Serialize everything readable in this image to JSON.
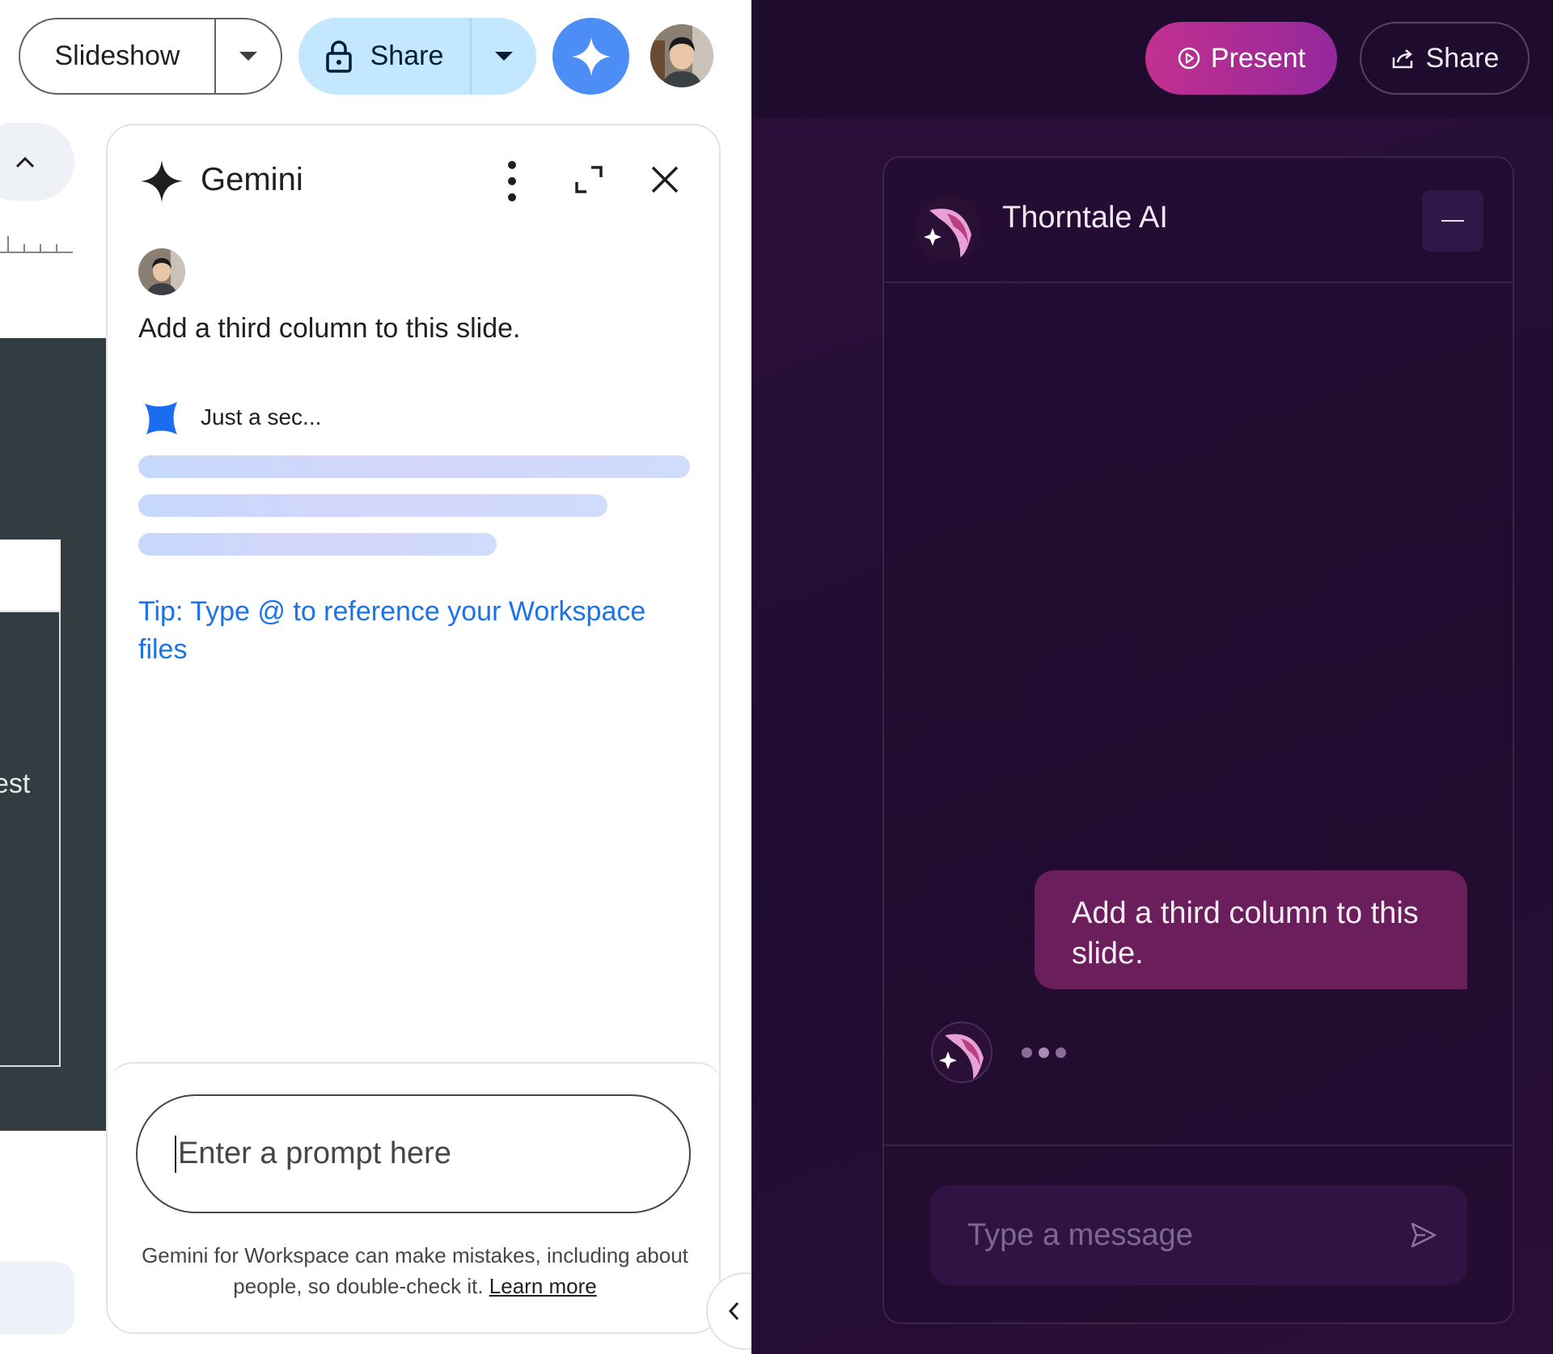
{
  "left": {
    "toolbar": {
      "slideshow_label": "Slideshow",
      "share_label": "Share"
    },
    "slide": {
      "partial_text": "est"
    },
    "gemini": {
      "title": "Gemini",
      "user_message": "Add a third column to this slide.",
      "loading_text": "Just a sec...",
      "tip": "Tip: Type @ to reference your Workspace files",
      "input_placeholder": "Enter a prompt here",
      "disclaimer": "Gemini for Workspace can make mistakes, including about people, so double-check it.",
      "learn_more": "Learn more"
    }
  },
  "right": {
    "present_label": "Present",
    "share_label": "Share",
    "chat": {
      "title": "Thorntale AI",
      "user_message": "Add a third column to this slide.",
      "input_placeholder": "Type a message"
    }
  },
  "icons": [
    "chevron-down-icon",
    "lock-icon",
    "gemini-spark-icon",
    "more-vert-icon",
    "expand-icon",
    "close-icon",
    "chevron-up-icon",
    "chevron-left-icon",
    "play-circle-icon",
    "share-icon",
    "thorntale-logo-icon",
    "send-icon"
  ],
  "colors": {
    "gemini_blue": "#4c8df6",
    "tip_link": "#1a73e8",
    "share_bg": "#c2e7ff",
    "present_gradient_start": "#c2308f",
    "present_gradient_end": "#94289c",
    "right_bg": "#210c31",
    "user_bubble": "#6a1f5c"
  }
}
